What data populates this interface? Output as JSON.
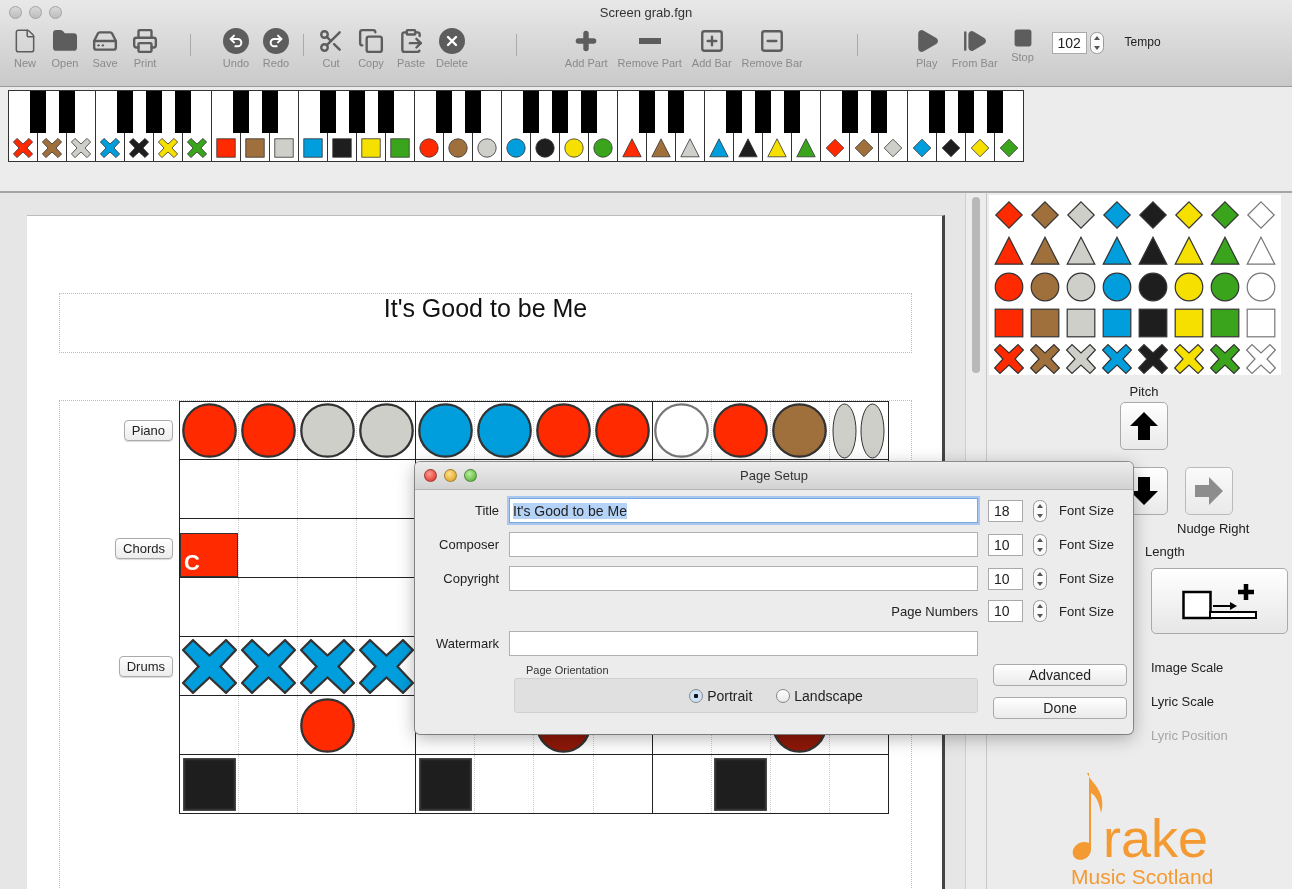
{
  "window": {
    "title": "Screen grab.fgn"
  },
  "toolbar": {
    "groups": [
      [
        {
          "kind": "new",
          "label": "New"
        },
        {
          "kind": "open",
          "label": "Open"
        },
        {
          "kind": "save",
          "label": "Save"
        },
        {
          "kind": "print",
          "label": "Print"
        }
      ],
      [
        {
          "kind": "undo",
          "label": "Undo"
        },
        {
          "kind": "redo",
          "label": "Redo"
        }
      ],
      [
        {
          "kind": "cut",
          "label": "Cut"
        },
        {
          "kind": "copy",
          "label": "Copy"
        },
        {
          "kind": "paste",
          "label": "Paste"
        },
        {
          "kind": "delete",
          "label": "Delete"
        }
      ],
      [
        {
          "kind": "add-part",
          "label": "Add Part"
        },
        {
          "kind": "remove-part",
          "label": "Remove Part"
        },
        {
          "kind": "add-bar",
          "label": "Add Bar"
        },
        {
          "kind": "remove-bar",
          "label": "Remove Bar"
        }
      ],
      [
        {
          "kind": "play",
          "label": "Play"
        },
        {
          "kind": "from-bar",
          "label": "From Bar"
        },
        {
          "kind": "stop",
          "label": "Stop"
        }
      ]
    ],
    "tempo": {
      "value": "102",
      "label": "Tempo"
    }
  },
  "keyboard": {
    "keys": [
      {
        "kind": "cross",
        "color": "#ff2a00"
      },
      {
        "kind": "cross",
        "color": "#a0703c"
      },
      {
        "kind": "cross",
        "color": "#cfcfca"
      },
      {
        "kind": "cross",
        "color": "#009edd"
      },
      {
        "kind": "cross",
        "color": "#1e1e1e"
      },
      {
        "kind": "cross",
        "color": "#f5e000"
      },
      {
        "kind": "cross",
        "color": "#3aa51c"
      },
      {
        "kind": "square",
        "color": "#ff2a00"
      },
      {
        "kind": "square",
        "color": "#a0703c"
      },
      {
        "kind": "square",
        "color": "#cfcfca"
      },
      {
        "kind": "square",
        "color": "#009edd"
      },
      {
        "kind": "square",
        "color": "#1e1e1e"
      },
      {
        "kind": "square",
        "color": "#f5e000"
      },
      {
        "kind": "square",
        "color": "#3aa51c"
      },
      {
        "kind": "circle",
        "color": "#ff2a00"
      },
      {
        "kind": "circle",
        "color": "#a0703c"
      },
      {
        "kind": "circle",
        "color": "#cfcfca"
      },
      {
        "kind": "circle",
        "color": "#009edd"
      },
      {
        "kind": "circle",
        "color": "#1e1e1e"
      },
      {
        "kind": "circle",
        "color": "#f5e000"
      },
      {
        "kind": "circle",
        "color": "#3aa51c"
      },
      {
        "kind": "triangle",
        "color": "#ff2a00"
      },
      {
        "kind": "triangle",
        "color": "#a0703c"
      },
      {
        "kind": "triangle",
        "color": "#cfcfca"
      },
      {
        "kind": "triangle",
        "color": "#009edd"
      },
      {
        "kind": "triangle",
        "color": "#1e1e1e"
      },
      {
        "kind": "triangle",
        "color": "#f5e000"
      },
      {
        "kind": "triangle",
        "color": "#3aa51c"
      },
      {
        "kind": "diamond",
        "color": "#ff2a00"
      },
      {
        "kind": "diamond",
        "color": "#a0703c"
      },
      {
        "kind": "diamond",
        "color": "#cfcfca"
      },
      {
        "kind": "diamond",
        "color": "#009edd"
      },
      {
        "kind": "diamond",
        "color": "#1e1e1e"
      },
      {
        "kind": "diamond",
        "color": "#f5e000"
      },
      {
        "kind": "diamond",
        "color": "#3aa51c"
      }
    ]
  },
  "score": {
    "title": "It's Good to be Me",
    "parts": [
      {
        "name": "Piano",
        "rows": [
          {
            "kind": "notes",
            "beats": [
              {
                "kind": "circle",
                "color": "#ff2a00"
              },
              {
                "kind": "circle",
                "color": "#ff2a00"
              },
              {
                "kind": "circle",
                "color": "#cfcfca"
              },
              {
                "kind": "circle",
                "color": "#cfcfca"
              },
              {
                "kind": "circle",
                "color": "#009edd"
              },
              {
                "kind": "circle",
                "color": "#009edd"
              },
              {
                "kind": "circle",
                "color": "#ff2a00"
              },
              {
                "kind": "circle",
                "color": "#ff2a00"
              },
              {
                "kind": "circle",
                "color": "#ffffff"
              },
              {
                "kind": "circle",
                "color": "#ff2a00"
              },
              {
                "kind": "circle",
                "color": "#a0703c"
              },
              {
                "kind": "oval-pair",
                "color": "#cfcfca"
              }
            ]
          },
          {
            "kind": "empty"
          }
        ]
      },
      {
        "name": "Chords",
        "rows": [
          {
            "kind": "notes",
            "beats": [
              {
                "kind": "chord",
                "color": "#ff2a00",
                "label": "C"
              }
            ]
          },
          {
            "kind": "empty"
          }
        ]
      },
      {
        "name": "Drums",
        "rows": [
          {
            "kind": "notes",
            "beats": [
              {
                "kind": "cross",
                "color": "#009edd"
              },
              {
                "kind": "cross",
                "color": "#009edd"
              },
              {
                "kind": "cross",
                "color": "#009edd"
              },
              {
                "kind": "cross",
                "color": "#009edd"
              }
            ]
          },
          {
            "kind": "notes",
            "beats": [
              {
                "kind": "empty"
              },
              {
                "kind": "empty"
              },
              {
                "kind": "circle",
                "color": "#ff2a00"
              },
              {
                "kind": "empty"
              },
              {
                "kind": "empty"
              },
              {
                "kind": "empty"
              },
              {
                "kind": "circle",
                "color": "#8e1808"
              },
              {
                "kind": "empty"
              },
              {
                "kind": "empty"
              },
              {
                "kind": "empty"
              },
              {
                "kind": "circle",
                "color": "#8e1808"
              }
            ]
          },
          {
            "kind": "notes",
            "beats": [
              {
                "kind": "square",
                "color": "#1e1e1e"
              },
              {
                "kind": "empty"
              },
              {
                "kind": "empty"
              },
              {
                "kind": "empty"
              },
              {
                "kind": "square",
                "color": "#1e1e1e"
              },
              {
                "kind": "empty"
              },
              {
                "kind": "empty"
              },
              {
                "kind": "empty"
              },
              {
                "kind": "empty"
              },
              {
                "kind": "square",
                "color": "#1e1e1e"
              }
            ]
          }
        ]
      }
    ]
  },
  "side_panel": {
    "palette": [
      {
        "kind": "diamond",
        "swatches": [
          {
            "color": "#ff2a00"
          },
          {
            "color": "#a0703c"
          },
          {
            "color": "#cfcfca"
          },
          {
            "color": "#009edd"
          },
          {
            "color": "#1e1e1e"
          },
          {
            "color": "#f5e000"
          },
          {
            "color": "#3aa51c"
          },
          {
            "color": "#ffffff"
          }
        ]
      },
      {
        "kind": "triangle",
        "swatches": [
          {
            "color": "#ff2a00"
          },
          {
            "color": "#a0703c"
          },
          {
            "color": "#cfcfca"
          },
          {
            "color": "#009edd"
          },
          {
            "color": "#1e1e1e"
          },
          {
            "color": "#f5e000"
          },
          {
            "color": "#3aa51c"
          },
          {
            "color": "#ffffff"
          }
        ]
      },
      {
        "kind": "circle",
        "swatches": [
          {
            "color": "#ff2a00"
          },
          {
            "color": "#a0703c"
          },
          {
            "color": "#cfcfca"
          },
          {
            "color": "#009edd"
          },
          {
            "color": "#1e1e1e"
          },
          {
            "color": "#f5e000"
          },
          {
            "color": "#3aa51c"
          },
          {
            "color": "#ffffff"
          }
        ]
      },
      {
        "kind": "square",
        "swatches": [
          {
            "color": "#ff2a00"
          },
          {
            "color": "#a0703c"
          },
          {
            "color": "#cfcfca"
          },
          {
            "color": "#009edd"
          },
          {
            "color": "#1e1e1e"
          },
          {
            "color": "#f5e000"
          },
          {
            "color": "#3aa51c"
          },
          {
            "color": "#ffffff"
          }
        ]
      },
      {
        "kind": "cross",
        "swatches": [
          {
            "color": "#ff2a00"
          },
          {
            "color": "#a0703c"
          },
          {
            "color": "#cfcfca"
          },
          {
            "color": "#009edd"
          },
          {
            "color": "#1e1e1e"
          },
          {
            "color": "#f5e000"
          },
          {
            "color": "#3aa51c"
          },
          {
            "color": "#ffffff"
          }
        ]
      }
    ],
    "pitch_label": "Pitch",
    "nudge_right": {
      "label": "Nudge Right",
      "disabled": true
    },
    "length_label": "Length",
    "settings": [
      {
        "label": "Image Scale",
        "disabled": false
      },
      {
        "label": "Lyric Scale",
        "disabled": false
      },
      {
        "label": "Lyric Position",
        "disabled": true
      }
    ],
    "logo": {
      "word": "rake",
      "subtitle": "Music Scotland"
    }
  },
  "dialog": {
    "title": "Page Setup",
    "fields": [
      {
        "kind": "text-size",
        "label": "Title",
        "value": "It's Good to be Me",
        "focused": true,
        "font_size": "18",
        "size_label": "Font Size"
      },
      {
        "kind": "text-size",
        "label": "Composer",
        "focused": false,
        "font_size": "10",
        "size_label": "Font Size"
      },
      {
        "kind": "text-size",
        "label": "Copyright",
        "focused": false,
        "font_size": "10",
        "size_label": "Font Size"
      },
      {
        "kind": "size-only",
        "label": "Page Numbers",
        "font_size": "10",
        "size_label": "Font Size"
      },
      {
        "kind": "text",
        "label": "Watermark",
        "focused": false
      }
    ],
    "orientation": {
      "legend": "Page Orientation",
      "options": [
        {
          "label": "Portrait",
          "selected": true
        },
        {
          "label": "Landscape",
          "selected": false
        }
      ]
    },
    "buttons": [
      "Advanced",
      "Done"
    ]
  }
}
